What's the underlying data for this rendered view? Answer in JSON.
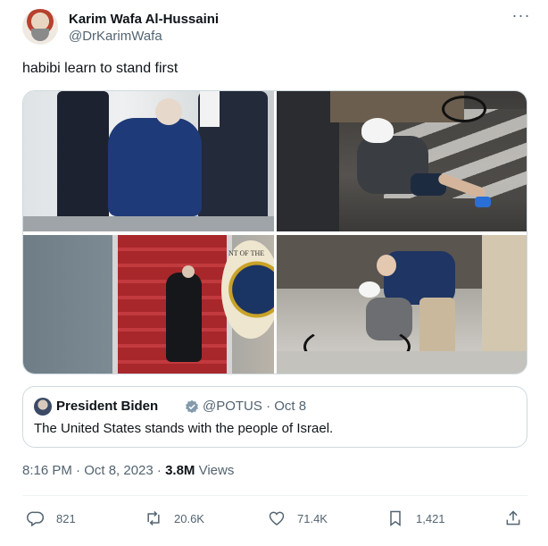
{
  "author": {
    "name": "Karim Wafa Al-Hussaini",
    "handle": "@DrKarimWafa"
  },
  "tweet": {
    "text": "habibi learn to stand first"
  },
  "media": {
    "photos": [
      "photo-fall-stairs-helped",
      "photo-fall-bicycle",
      "photo-air-force-one-stairs",
      "photo-bicycle-fall-group"
    ],
    "seal_text": "NT OF THE"
  },
  "quoted": {
    "name": "President Biden",
    "handle_date": "@POTUS · Oct 8",
    "text": "The United States stands with the people of Israel.",
    "badge_color": "#829aab"
  },
  "meta": {
    "time_date": "8:16 PM · Oct 8, 2023 · ",
    "views_count": "3.8M",
    "views_label": " Views"
  },
  "actions": {
    "replies": "821",
    "reposts": "20.6K",
    "likes": "71.4K",
    "bookmarks": "1,421"
  },
  "icons": [
    "more-icon",
    "reply-icon",
    "repost-icon",
    "like-icon",
    "bookmark-icon",
    "share-icon",
    "verified-badge-icon"
  ],
  "colors": {
    "text_primary": "#0f1419",
    "text_secondary": "#536471",
    "border": "#cfd9de"
  }
}
